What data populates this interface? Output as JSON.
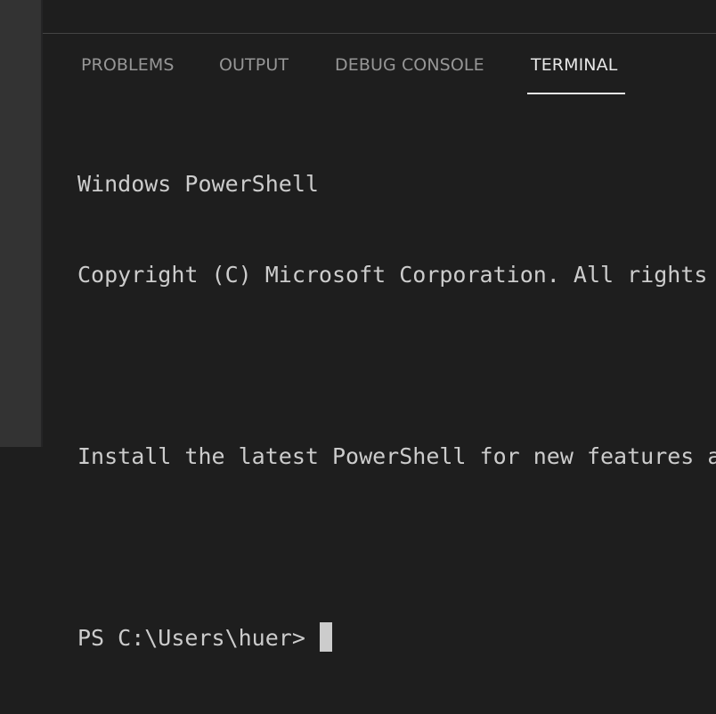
{
  "panel": {
    "tabs": [
      {
        "label": "PROBLEMS"
      },
      {
        "label": "OUTPUT"
      },
      {
        "label": "DEBUG CONSOLE"
      },
      {
        "label": "TERMINAL",
        "active": true
      }
    ]
  },
  "terminal": {
    "lines": [
      "Windows PowerShell",
      "Copyright (C) Microsoft Corporation. All rights",
      "",
      "Install the latest PowerShell for new features a",
      ""
    ],
    "prompt": "PS C:\\Users\\huer>"
  },
  "colors": {
    "background": "#1e1e1e",
    "activity_bar": "#333333",
    "tab_inactive": "#969696",
    "tab_active": "#e7e7e7",
    "terminal_text": "#cccccc"
  }
}
